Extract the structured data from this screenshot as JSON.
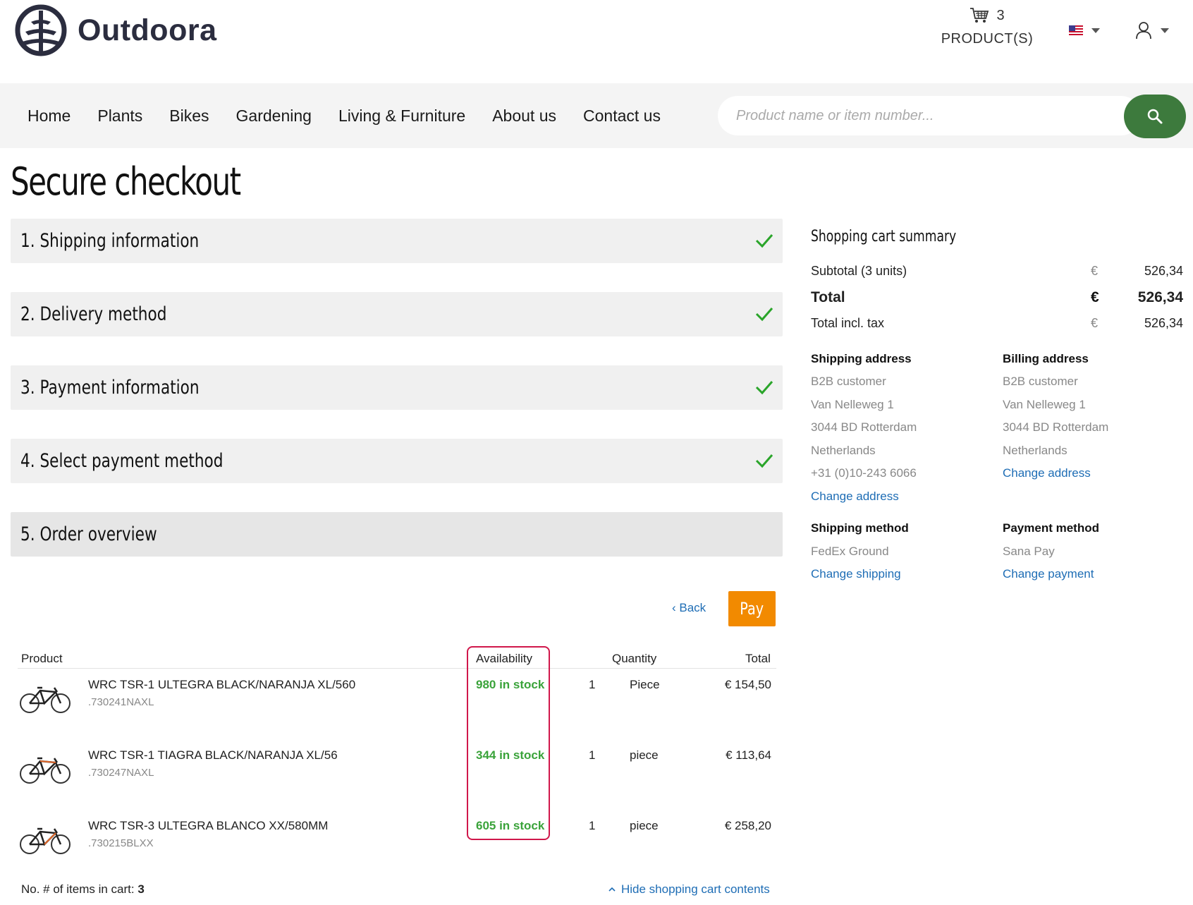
{
  "brand": {
    "name": "Outdoora"
  },
  "cart": {
    "count": "3",
    "label": "PRODUCT(S)",
    "icon": "cart-icon"
  },
  "language": {
    "icon": "us-flag-icon"
  },
  "account": {
    "icon": "user-icon"
  },
  "nav": [
    "Home",
    "Plants",
    "Bikes",
    "Gardening",
    "Living & Furniture",
    "About us",
    "Contact us"
  ],
  "search": {
    "placeholder": "Product name or item number...",
    "icon": "search-icon"
  },
  "page": {
    "title": "Secure checkout"
  },
  "steps": [
    {
      "label": "1.  Shipping information",
      "complete": true
    },
    {
      "label": "2.  Delivery method",
      "complete": true
    },
    {
      "label": "3.  Payment information",
      "complete": true
    },
    {
      "label": "4.  Select payment method",
      "complete": true
    },
    {
      "label": "5.  Order overview",
      "complete": false
    }
  ],
  "actions": {
    "back": "‹ Back",
    "pay": "Pay"
  },
  "table": {
    "headers": {
      "product": "Product",
      "availability": "Availability",
      "quantity": "Quantity",
      "total": "Total"
    },
    "rows": [
      {
        "name": "WRC TSR-1 ULTEGRA BLACK/NARANJA XL/560",
        "code": ".730241NAXL",
        "stock": "980 in stock",
        "qty": "1",
        "unit": "Piece",
        "total": "€ 154,50"
      },
      {
        "name": "WRC TSR-1 TIAGRA BLACK/NARANJA XL/56",
        "code": ".730247NAXL",
        "stock": "344 in stock",
        "qty": "1",
        "unit": "piece",
        "total": "€ 113,64"
      },
      {
        "name": "WRC TSR-3 ULTEGRA BLANCO XX/580MM",
        "code": ".730215BLXX",
        "stock": "605 in stock",
        "qty": "1",
        "unit": "piece",
        "total": "€ 258,20"
      }
    ],
    "items_label": "No. # of items in cart:",
    "items_count": "3",
    "hide_link": "Hide shopping cart contents"
  },
  "summary": {
    "title": "Shopping cart summary",
    "subtotal_label": "Subtotal (3 units)",
    "subtotal_currency": "€",
    "subtotal": "526,34",
    "total_label": "Total",
    "total_currency": "€",
    "total": "526,34",
    "tax_label": "Total incl. tax",
    "tax_currency": "€",
    "tax_total": "526,34",
    "shipping_address": {
      "title": "Shipping address",
      "lines": [
        "B2B customer",
        "Van Nelleweg 1",
        "3044 BD Rotterdam",
        "Netherlands",
        "+31 (0)10-243 6066"
      ],
      "link": "Change address"
    },
    "billing_address": {
      "title": "Billing address",
      "lines": [
        "B2B customer",
        "Van Nelleweg 1",
        "3044 BD Rotterdam",
        "Netherlands"
      ],
      "link": "Change address"
    },
    "shipping_method": {
      "title": "Shipping method",
      "value": "FedEx Ground",
      "link": "Change shipping"
    },
    "payment_method": {
      "title": "Payment method",
      "value": "Sana Pay",
      "link": "Change payment"
    }
  },
  "colors": {
    "brand_dark": "#2b2d3f",
    "accent_green": "#3d7a3d",
    "stock_green": "#3aa33a",
    "pay_orange": "#f28a00",
    "link_blue": "#1e6db5",
    "highlight_red": "#d0174b"
  }
}
